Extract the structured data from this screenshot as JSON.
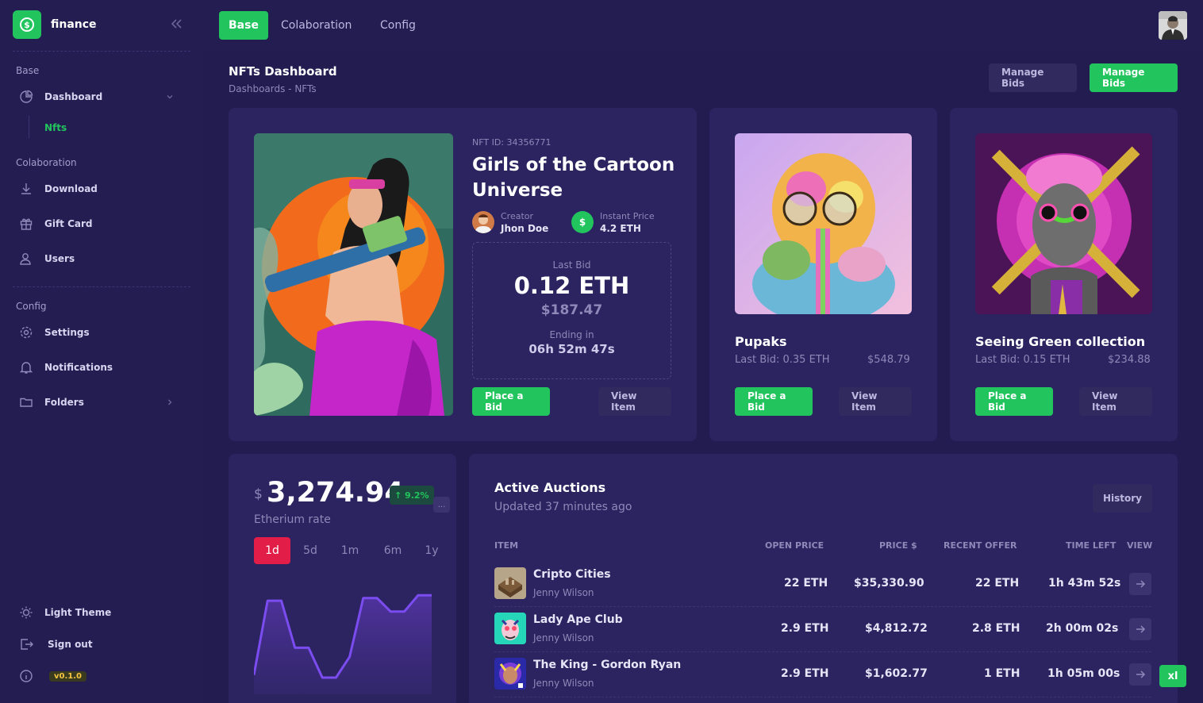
{
  "brand": {
    "name": "finance",
    "logo_icon": "dollar-coin-icon",
    "color": "#21c45d"
  },
  "sidebar": {
    "sections": {
      "base": "Base",
      "collaboration": "Colaboration",
      "config": "Config"
    },
    "items": {
      "dashboard": "Dashboard",
      "nfts": "Nfts",
      "download": "Download",
      "gift_card": "Gift Card",
      "users": "Users",
      "settings": "Settings",
      "notifications": "Notifications",
      "folders": "Folders"
    },
    "footer": {
      "theme": "Light Theme",
      "sign_out": "Sign out",
      "version": "v0.1.0"
    }
  },
  "topbar": {
    "tabs": [
      "Base",
      "Colaboration",
      "Config"
    ],
    "active_tab": "Base"
  },
  "page": {
    "title": "NFTs Dashboard",
    "breadcrumb": "Dashboards  - NFTs",
    "manage_bids_dark": "Manage Bids",
    "manage_bids_green": "Manage Bids"
  },
  "featured": {
    "nft_id": "NFT ID: 34356771",
    "title_line1": "Girls of the Cartoon",
    "title_line2": "Universe",
    "creator_label": "Creator",
    "creator_name": "Jhon Doe",
    "price_label": "Instant Price",
    "price_value": "4.2 ETH",
    "last_bid_label": "Last Bid",
    "last_bid_eth": "0.12 ETH",
    "last_bid_usd": "$187.47",
    "ending_label": "Ending in",
    "ending_value": "06h 52m 47s",
    "place_bid": "Place a Bid",
    "view_item": "View Item"
  },
  "cards": [
    {
      "title": "Pupaks",
      "last_bid": "Last Bid: 0.35 ETH",
      "usd": "$548.79",
      "place_bid": "Place a Bid",
      "view_item": "View Item"
    },
    {
      "title": "Seeing Green collection",
      "last_bid": "Last Bid: 0.15 ETH",
      "usd": "$234.88",
      "place_bid": "Place a Bid",
      "view_item": "View Item"
    }
  ],
  "rate": {
    "currency": "$",
    "value": "3,274.94",
    "change": "↑ 9.2%",
    "label": "Etherium rate",
    "periods": [
      "1d",
      "5d",
      "1m",
      "6m",
      "1y"
    ],
    "active_period": "1d",
    "more": "..."
  },
  "chart_data": {
    "type": "area",
    "series": [
      {
        "values": [
          10,
          92,
          92,
          40,
          40,
          7,
          7,
          30,
          95,
          95,
          80,
          80,
          98,
          98
        ]
      }
    ]
  },
  "auctions": {
    "title": "Active Auctions",
    "subtitle": "Updated 37 minutes ago",
    "history": "History",
    "columns": [
      "ITEM",
      "OPEN PRICE",
      "PRICE $",
      "RECENT OFFER",
      "TIME LEFT",
      "VIEW"
    ],
    "rows": [
      {
        "name": "Cripto Cities",
        "owner": "Jenny Wilson",
        "open": "22 ETH",
        "price": "$35,330.90",
        "offer": "22 ETH",
        "time": "1h 43m 52s"
      },
      {
        "name": "Lady Ape Club",
        "owner": "Jenny Wilson",
        "open": "2.9 ETH",
        "price": "$4,812.72",
        "offer": "2.8 ETH",
        "time": "2h 00m 02s"
      },
      {
        "name": "The King - Gordon Ryan",
        "owner": "Jenny Wilson",
        "open": "2.9 ETH",
        "price": "$1,602.77",
        "offer": "1 ETH",
        "time": "1h 05m 00s"
      }
    ]
  },
  "xl_button": "xl"
}
